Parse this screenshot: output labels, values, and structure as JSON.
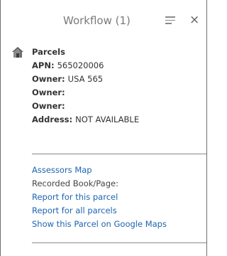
{
  "header": {
    "title": "Workflow (1)",
    "menu_icon": "hamburger-menu-icon",
    "close_glyph": "×"
  },
  "feature": {
    "layer_icon": "house-icon",
    "layer_name": "Parcels",
    "fields": [
      {
        "key": "APN:",
        "value": "565020006"
      },
      {
        "key": "Owner:",
        "value": "USA 565"
      },
      {
        "key": "Owner:",
        "value": ""
      },
      {
        "key": "Owner:",
        "value": ""
      },
      {
        "key": "Address:",
        "value": "NOT AVAILABLE"
      }
    ]
  },
  "actions": {
    "assessors_map": "Assessors Map",
    "recorded_book_page": "Recorded Book/Page:",
    "report_this": "Report for this parcel",
    "report_all": "Report for all parcels",
    "google_maps": "Show this Parcel on Google Maps"
  },
  "colors": {
    "link": "#1c64b0",
    "title": "#7a7a7a",
    "text": "#333333"
  }
}
